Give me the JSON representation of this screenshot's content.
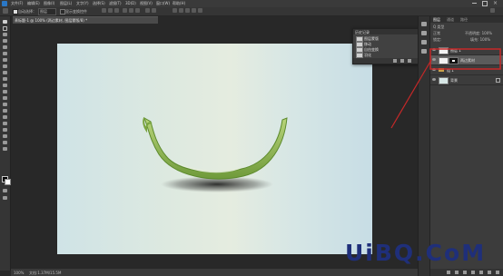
{
  "menubar": {
    "items": [
      "文件(F)",
      "编辑(E)",
      "图像(I)",
      "图层(L)",
      "文字(Y)",
      "选择(S)",
      "滤镜(T)",
      "3D(D)",
      "视图(V)",
      "窗口(W)",
      "帮助(H)"
    ]
  },
  "optionsbar": {
    "items": [
      "自动选择：",
      "图层",
      "显示变换控件"
    ]
  },
  "document": {
    "tab_title": "未标题-1 @ 100% (两边素材, 图层蒙版/8) *",
    "close_glyph": "×"
  },
  "history_panel": {
    "title": "历史记录",
    "items": [
      "图层蒙版",
      "移动",
      "自由变换",
      "羽化"
    ]
  },
  "layers_panel": {
    "tabs": [
      "图层",
      "通道",
      "路径"
    ],
    "kind_label": "Q 类型",
    "blend_mode": "正常",
    "opacity": "不透明度: 100%",
    "lock_label": "锁定:",
    "fill": "填充: 100%",
    "layers": [
      {
        "name": "图层 1",
        "selected": false,
        "has_mask": false
      },
      {
        "name": "两边素材",
        "selected": true,
        "has_mask": true
      },
      {
        "name": "组 1",
        "selected": false,
        "has_mask": false
      },
      {
        "name": "背景",
        "selected": false,
        "has_mask": false
      }
    ]
  },
  "statusbar": {
    "zoom": "100%",
    "doc_info": "文档:1.37M/15.5M"
  },
  "watermark": {
    "text": "UiBQ.CoM"
  },
  "colors": {
    "accent": "#c62828",
    "canvas_left": "#cfe3e6",
    "canvas_right": "#c7dde5"
  }
}
